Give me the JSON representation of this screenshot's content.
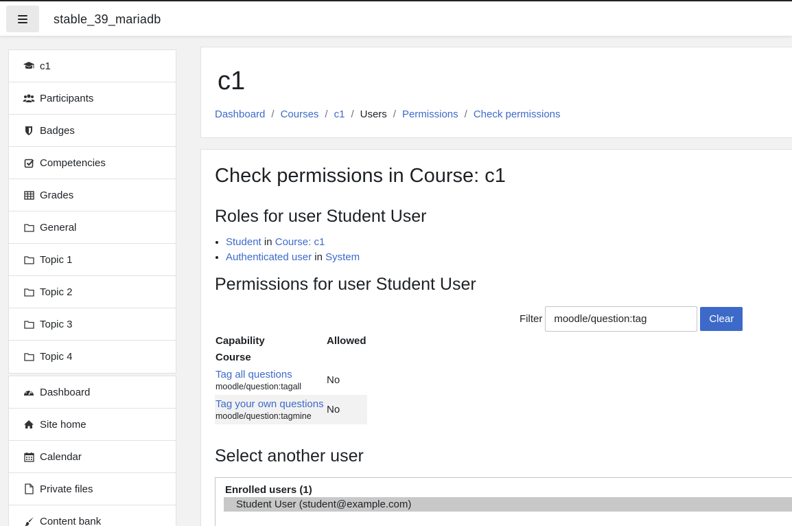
{
  "navbar": {
    "site_name": "stable_39_mariadb"
  },
  "drawer": {
    "group1": [
      {
        "label": "c1",
        "icon": "graduation-cap-icon"
      },
      {
        "label": "Participants",
        "icon": "users-icon"
      },
      {
        "label": "Badges",
        "icon": "shield-icon"
      },
      {
        "label": "Competencies",
        "icon": "check-square-icon"
      },
      {
        "label": "Grades",
        "icon": "table-icon"
      },
      {
        "label": "General",
        "icon": "folder-icon"
      },
      {
        "label": "Topic 1",
        "icon": "folder-icon"
      },
      {
        "label": "Topic 2",
        "icon": "folder-icon"
      },
      {
        "label": "Topic 3",
        "icon": "folder-icon"
      },
      {
        "label": "Topic 4",
        "icon": "folder-icon"
      }
    ],
    "group2": [
      {
        "label": "Dashboard",
        "icon": "tachometer-icon"
      },
      {
        "label": "Site home",
        "icon": "home-icon"
      },
      {
        "label": "Calendar",
        "icon": "calendar-icon"
      },
      {
        "label": "Private files",
        "icon": "file-icon"
      },
      {
        "label": "Content bank",
        "icon": "paint-brush-icon"
      }
    ]
  },
  "header": {
    "title": "c1",
    "breadcrumb": {
      "dashboard": "Dashboard",
      "courses": "Courses",
      "course": "c1",
      "users": "Users",
      "permissions": "Permissions",
      "check": "Check permissions",
      "separator": "/"
    }
  },
  "main": {
    "title": "Check permissions in Course: c1",
    "roles_heading": "Roles for user Student User",
    "roles": [
      {
        "role": "Student",
        "in": "in",
        "context": "Course: c1"
      },
      {
        "role": "Authenticated user",
        "in": "in",
        "context": "System"
      }
    ],
    "permissions_heading": "Permissions for user Student User",
    "filter": {
      "label": "Filter",
      "value": "moodle/question:tag",
      "clear_label": "Clear"
    },
    "table": {
      "col_capability": "Capability",
      "col_allowed": "Allowed",
      "context": "Course",
      "rows": [
        {
          "name": "Tag all questions",
          "code": "moodle/question:tagall",
          "allowed": "No"
        },
        {
          "name": "Tag your own questions",
          "code": "moodle/question:tagmine",
          "allowed": "No"
        }
      ]
    },
    "select_heading": "Select another user",
    "user_select": {
      "group_label": "Enrolled users (1)",
      "option": "Student User (student@example.com)"
    }
  }
}
